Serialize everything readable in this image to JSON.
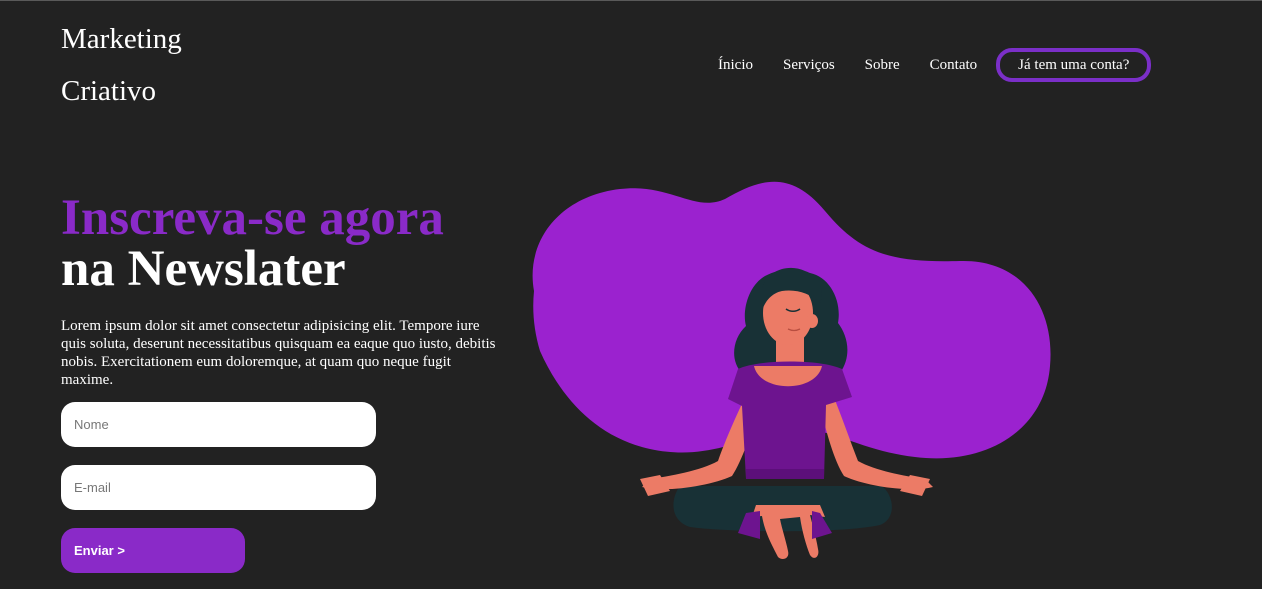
{
  "logo": {
    "line1": "Marketing",
    "line2": "Criativo"
  },
  "nav": {
    "items": [
      {
        "label": "Ínicio"
      },
      {
        "label": "Serviços"
      },
      {
        "label": "Sobre"
      },
      {
        "label": "Contato"
      }
    ],
    "login_label": "Já tem uma conta?"
  },
  "hero": {
    "title_accent": "Inscreva-se agora",
    "title_main": "na Newslater",
    "description": "Lorem ipsum dolor sit amet consectetur adipisicing elit. Tempore iure quis soluta, deserunt necessitatibus quisquam ea eaque quo iusto, debitis nobis. Exercitationem eum doloremque, at quam quo neque fugit maxime."
  },
  "form": {
    "name_placeholder": "Nome",
    "email_placeholder": "E-mail",
    "submit_label": "Enviar >"
  },
  "colors": {
    "background": "#222222",
    "accent": "#8a2ac8",
    "blob": "#9b22cf",
    "skin": "#ec7b66",
    "hair": "#183136",
    "shirt": "#6d148f"
  },
  "illustration": {
    "icon": "meditating-woman-icon"
  }
}
